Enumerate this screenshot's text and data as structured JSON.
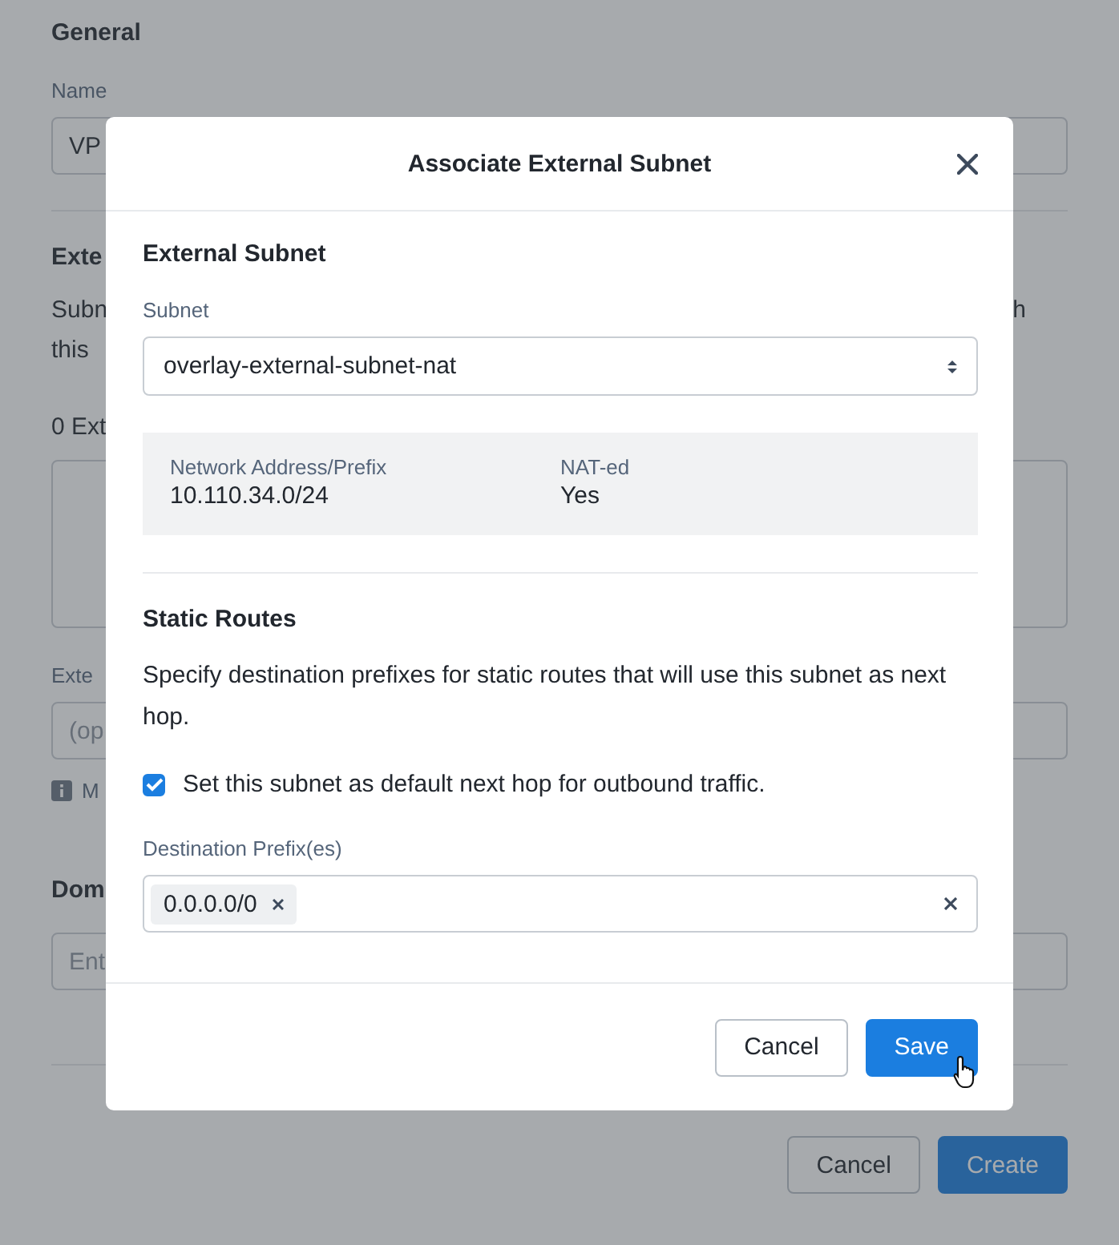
{
  "background": {
    "section_title": "General",
    "name_label": "Name",
    "name_value": "VP",
    "external_title": "Exte",
    "description_start": "Subn",
    "description_end": "h",
    "description_line2": "this",
    "count_text": "0 Ext",
    "external_label": "Exte",
    "external_placeholder": "(op",
    "info_text": "M",
    "domain_title": "Dom",
    "domain_placeholder": "Ent",
    "buttons": [
      {
        "label": "Cancel",
        "kind": "secondary"
      },
      {
        "label": "Create",
        "kind": "primary"
      }
    ]
  },
  "dialog": {
    "title": "Associate External Subnet",
    "section_title": "External Subnet",
    "subnet_label": "Subnet",
    "subnet_value": "overlay-external-subnet-nat",
    "details": [
      {
        "label": "Network Address/Prefix",
        "value": "10.110.34.0/24"
      },
      {
        "label": "NAT-ed",
        "value": "Yes"
      }
    ],
    "routes_title": "Static Routes",
    "routes_description": "Specify destination prefixes for static routes that will use this subnet as next hop.",
    "default_hop": {
      "label": "Set this subnet as default next hop for outbound traffic.",
      "checked": true
    },
    "prefix_label": "Destination Prefix(es)",
    "prefixes": [
      "0.0.0.0/0"
    ],
    "buttons": [
      {
        "label": "Cancel",
        "kind": "secondary"
      },
      {
        "label": "Save",
        "kind": "primary"
      }
    ]
  }
}
